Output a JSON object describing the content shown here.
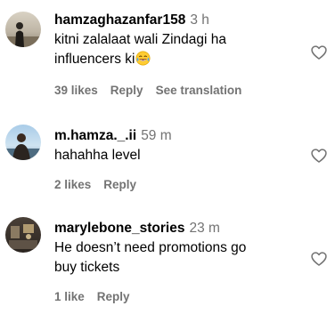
{
  "comments": [
    {
      "username": "hamzaghazanfar158",
      "time": "3 h",
      "text_line1": "kitni zalalaat wali Zindagi ha",
      "text_line2": "influencers ki",
      "emoji_icon": "face-with-tears-of-joy-emoji",
      "likes": "39 likes",
      "reply": "Reply",
      "translate": "See translation"
    },
    {
      "username": "m.hamza._.ii",
      "time": "59 m",
      "text_line1": "hahahha level",
      "likes": "2 likes",
      "reply": "Reply"
    },
    {
      "username": "marylebone_stories",
      "time": "23 m",
      "text_line1": "He doesn’t need promotions go",
      "text_line2": "buy tickets",
      "likes": "1 like",
      "reply": "Reply"
    }
  ],
  "colors": {
    "secondary_text": "#737373",
    "primary_text": "#000000",
    "background": "#ffffff"
  },
  "icons": {
    "like": "heart-outline-icon"
  }
}
